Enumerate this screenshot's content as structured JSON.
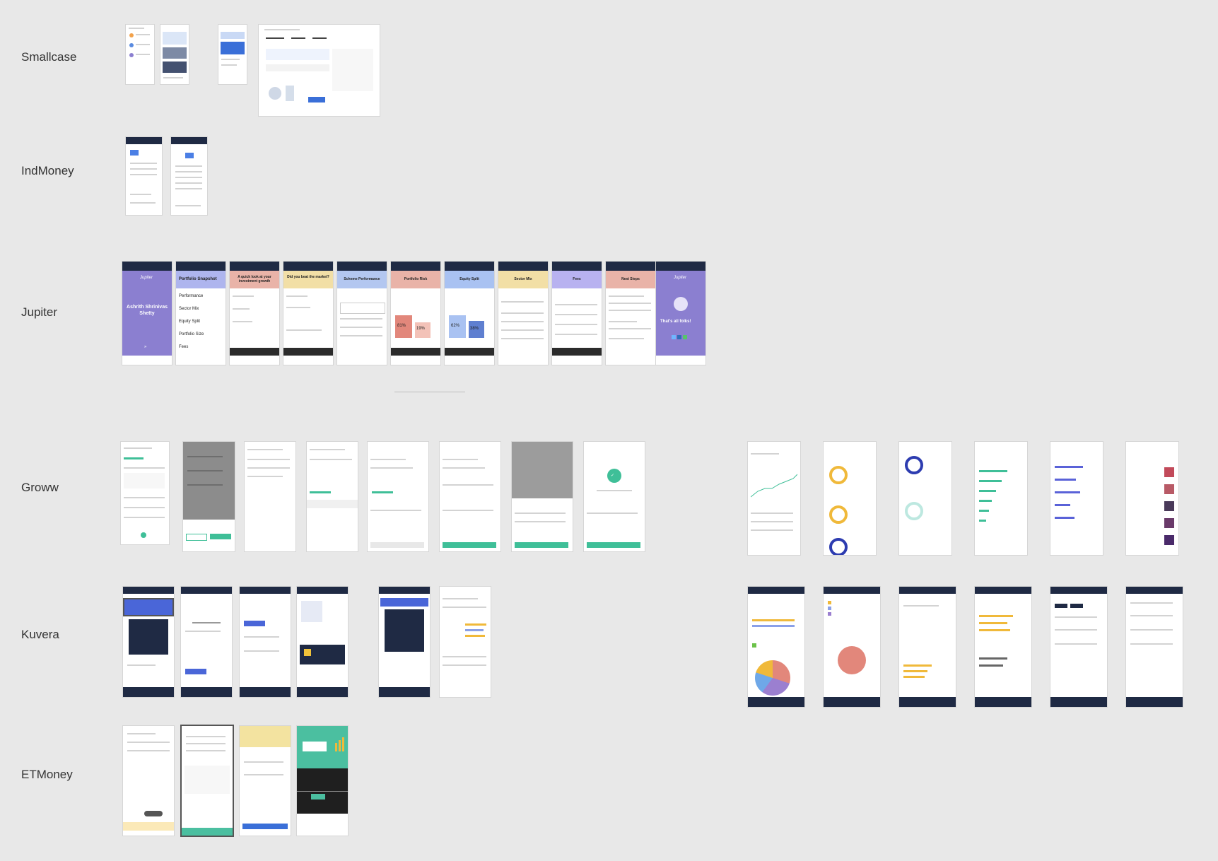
{
  "sections": {
    "smallcase": "Smallcase",
    "indmoney": "IndMoney",
    "jupiter": "Jupiter",
    "groww": "Groww",
    "kuvera": "Kuvera",
    "etmoney": "ETMoney"
  },
  "jupiter_screens": [
    "Ashrith Shrinivas Shetty",
    "Portfolio Snapshot",
    "A quick look at your investment growth",
    "Did you beat the market?",
    "Scheme Performance",
    "Portfolio Risk",
    "Equity Split",
    "Sector Mix",
    "Fees",
    "Next Steps",
    "That's all folks!"
  ],
  "jupiter_snapshot_items": [
    "Performance",
    "Sector Mix",
    "Equity Split",
    "Portfolio Size",
    "Fees"
  ],
  "jupiter_values": {
    "risk_high": "81%",
    "risk_low": "19%",
    "equity_a": "62%",
    "equity_b": "38%",
    "brand": "Jupiter"
  },
  "colors": {
    "jupiter_purple": "#8b7fd0",
    "groww_green": "#3fbf98",
    "kuvera_navy": "#1f2a44",
    "etmoney_green": "#4bbfa0"
  }
}
